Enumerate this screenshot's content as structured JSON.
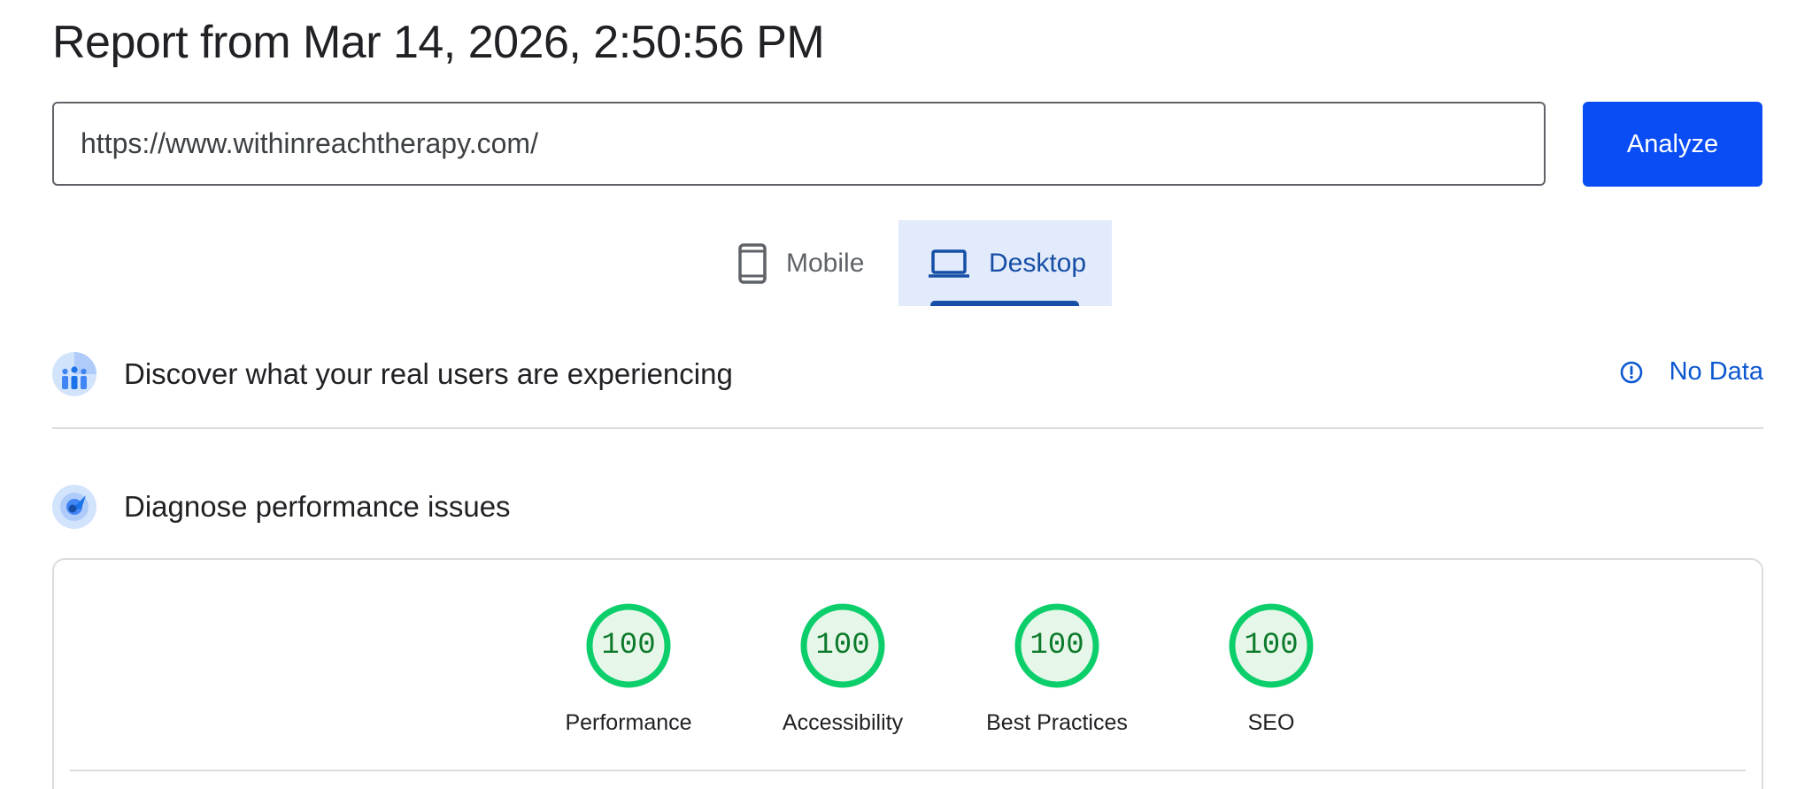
{
  "report": {
    "title": "Report from Mar 14, 2026, 2:50:56 PM"
  },
  "search": {
    "url_value": "https://www.withinreachtherapy.com/",
    "analyze_label": "Analyze"
  },
  "tabs": [
    {
      "label": "Mobile",
      "icon": "smartphone-icon",
      "selected": false
    },
    {
      "label": "Desktop",
      "icon": "laptop-icon",
      "selected": true
    }
  ],
  "field_data": {
    "title": "Discover what your real users are experiencing",
    "status_label": "No Data",
    "status_icon": "info-icon"
  },
  "lab_data": {
    "title": "Diagnose performance issues",
    "scores": [
      {
        "label": "Performance",
        "value": "100"
      },
      {
        "label": "Accessibility",
        "value": "100"
      },
      {
        "label": "Best Practices",
        "value": "100"
      },
      {
        "label": "SEO",
        "value": "100"
      }
    ]
  },
  "colors": {
    "accent": "#0b4df5",
    "selected_tab_bg": "#e1ebfb",
    "selected_tab_text": "#174ea6",
    "link": "#0b57d0",
    "pass_green": "#0cce6b",
    "pass_fill": "#e6f7ea",
    "pass_text": "#0d7a2b"
  }
}
